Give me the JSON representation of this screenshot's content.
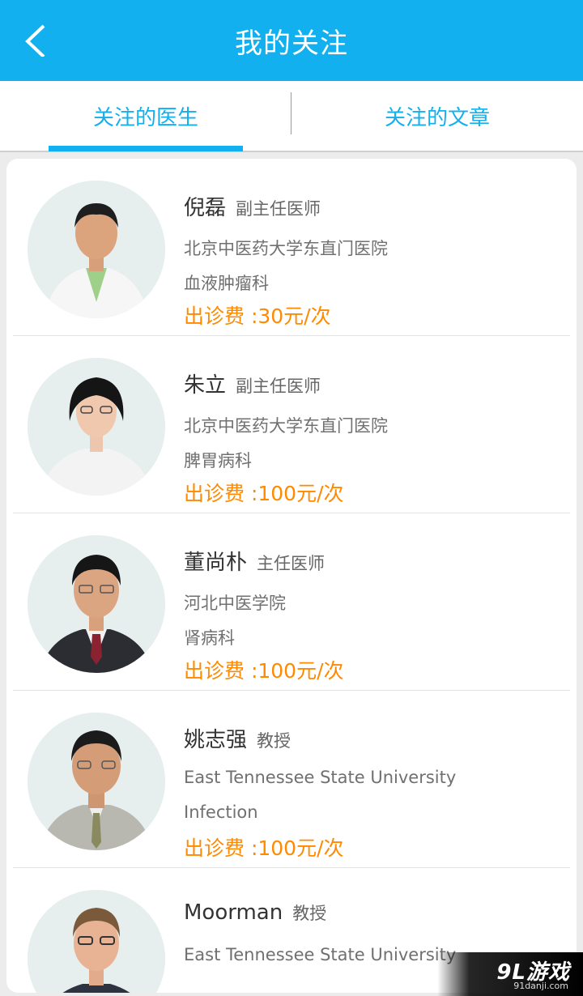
{
  "header": {
    "title": "我的关注"
  },
  "tabs": [
    {
      "label": "关注的医生",
      "active": true
    },
    {
      "label": "关注的文章",
      "active": false
    }
  ],
  "colors": {
    "primary": "#12b0ef",
    "fee": "#ff8a00"
  },
  "doctors": [
    {
      "name": "倪磊",
      "title": "副主任医师",
      "hospital": "北京中医药大学东直门医院",
      "department": "血液肿瘤科",
      "fee": "出诊费 :30元/次"
    },
    {
      "name": "朱立",
      "title": "副主任医师",
      "hospital": "北京中医药大学东直门医院",
      "department": "脾胃病科",
      "fee": "出诊费 :100元/次"
    },
    {
      "name": "董尚朴",
      "title": "主任医师",
      "hospital": "河北中医学院",
      "department": "肾病科",
      "fee": "出诊费 :100元/次"
    },
    {
      "name": "姚志强",
      "title": "教授",
      "hospital": "East Tennessee State University",
      "department": "Infection",
      "fee": "出诊费 :100元/次"
    },
    {
      "name": "Moorman",
      "title": "教授",
      "hospital": "East Tennessee State University",
      "department": "",
      "fee": ""
    }
  ],
  "watermark": {
    "logo": "9L游戏",
    "url": "91danji.com"
  }
}
